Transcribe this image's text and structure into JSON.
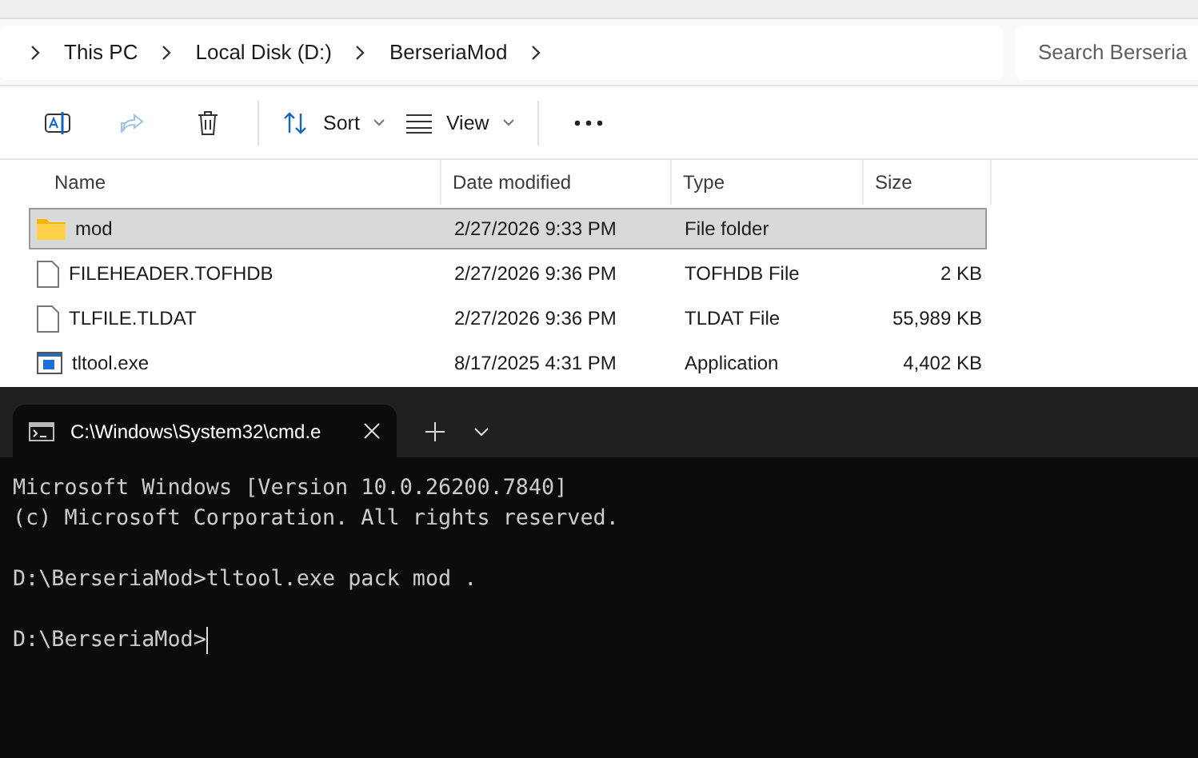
{
  "explorer": {
    "breadcrumbs": [
      "This PC",
      "Local Disk (D:)",
      "BerseriaMod"
    ],
    "search": {
      "placeholder": "Search Berseria"
    },
    "toolbar": [
      {
        "kind": "rename"
      },
      {
        "kind": "share",
        "disabled": true
      },
      {
        "kind": "delete"
      },
      {
        "kind": "sort",
        "label": "Sort"
      },
      {
        "kind": "view",
        "label": "View"
      },
      {
        "kind": "more"
      }
    ],
    "columns": [
      "Name",
      "Date modified",
      "Type",
      "Size"
    ],
    "rows": [
      {
        "kind": "folder",
        "name": "mod",
        "date": "2/27/2026 9:33 PM",
        "type": "File folder",
        "selected": true
      },
      {
        "kind": "file",
        "name": "FILEHEADER.TOFHDB",
        "date": "2/27/2026 9:36 PM",
        "type": "TOFHDB File",
        "size": "2 KB",
        "selected": false
      },
      {
        "kind": "file",
        "name": "TLFILE.TLDAT",
        "date": "2/27/2026 9:36 PM",
        "type": "TLDAT File",
        "size": "55,989 KB",
        "selected": false
      },
      {
        "kind": "app",
        "name": "tltool.exe",
        "date": "8/17/2025 4:31 PM",
        "type": "Application",
        "size": "4,402 KB",
        "selected": false
      }
    ]
  },
  "terminal": {
    "tab_title": "C:\\Windows\\System32\\cmd.e",
    "lines": [
      {
        "kind": "text",
        "text": "Microsoft Windows [Version 10.0.26200.7840]"
      },
      {
        "kind": "text",
        "text": "(c) Microsoft Corporation. All rights reserved."
      },
      {
        "kind": "blank"
      },
      {
        "kind": "text",
        "text": "D:\\BerseriaMod>tltool.exe pack mod ."
      },
      {
        "kind": "blank"
      },
      {
        "kind": "text",
        "text": "D:\\BerseriaMod>"
      }
    ],
    "cursor": true
  }
}
